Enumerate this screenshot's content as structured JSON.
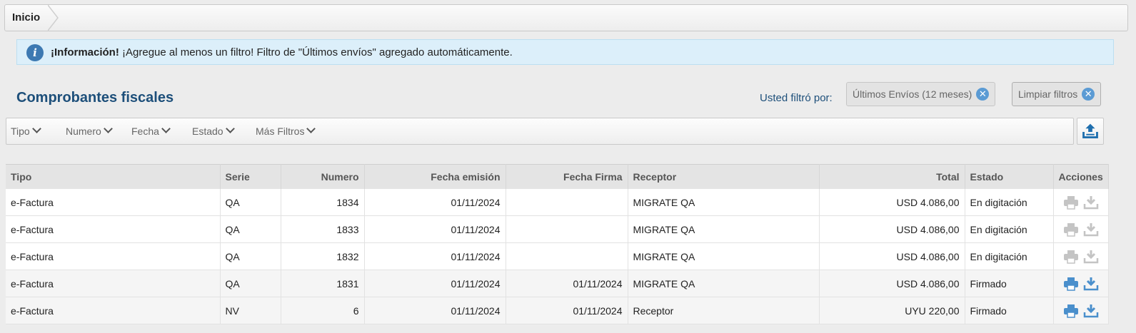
{
  "breadcrumb": {
    "home": "Inicio"
  },
  "alert": {
    "title": "¡Información!",
    "message": "¡Agregue al menos un filtro! Filtro de \"Últimos envíos\" agregado automáticamente."
  },
  "header": {
    "title": "Comprobantes fiscales",
    "filter_label": "Usted filtró por:",
    "active_filter": "Últimos Envíos (12 meses)",
    "clear_label": "Limpiar filtros"
  },
  "filters": [
    "Tipo",
    "Numero",
    "Fecha",
    "Estado",
    "Más Filtros"
  ],
  "table": {
    "columns": [
      "Tipo",
      "Serie",
      "Numero",
      "Fecha emisión",
      "Fecha Firma",
      "Receptor",
      "Total",
      "Estado",
      "Acciones"
    ],
    "rows": [
      {
        "tipo": "e-Factura",
        "serie": "QA",
        "numero": "1834",
        "fecha_emision": "01/11/2024",
        "fecha_firma": "",
        "receptor": "MIGRATE QA",
        "total": "USD 4.086,00",
        "estado": "En digitación",
        "actions_enabled": false
      },
      {
        "tipo": "e-Factura",
        "serie": "QA",
        "numero": "1833",
        "fecha_emision": "01/11/2024",
        "fecha_firma": "",
        "receptor": "MIGRATE QA",
        "total": "USD 4.086,00",
        "estado": "En digitación",
        "actions_enabled": false
      },
      {
        "tipo": "e-Factura",
        "serie": "QA",
        "numero": "1832",
        "fecha_emision": "01/11/2024",
        "fecha_firma": "",
        "receptor": "MIGRATE QA",
        "total": "USD 4.086,00",
        "estado": "En digitación",
        "actions_enabled": false
      },
      {
        "tipo": "e-Factura",
        "serie": "QA",
        "numero": "1831",
        "fecha_emision": "01/11/2024",
        "fecha_firma": "01/11/2024",
        "receptor": "MIGRATE QA",
        "total": "USD 4.086,00",
        "estado": "Firmado",
        "actions_enabled": true
      },
      {
        "tipo": "e-Factura",
        "serie": "NV",
        "numero": "6",
        "fecha_emision": "01/11/2024",
        "fecha_firma": "01/11/2024",
        "receptor": "Receptor",
        "total": "UYU 220,00",
        "estado": "Firmado",
        "actions_enabled": true
      }
    ]
  },
  "icons": {
    "info": "info-icon",
    "close": "close-circle-icon",
    "chevron": "chevron-down-icon",
    "export": "upload-tray-icon",
    "print": "printer-icon",
    "download": "download-icon"
  },
  "colors": {
    "accent": "#1d4f7a",
    "info_bg": "#dceffa",
    "icon_active": "#4a8fcc",
    "icon_disabled": "#c4c4c4",
    "export_icon": "#1f6fae"
  }
}
